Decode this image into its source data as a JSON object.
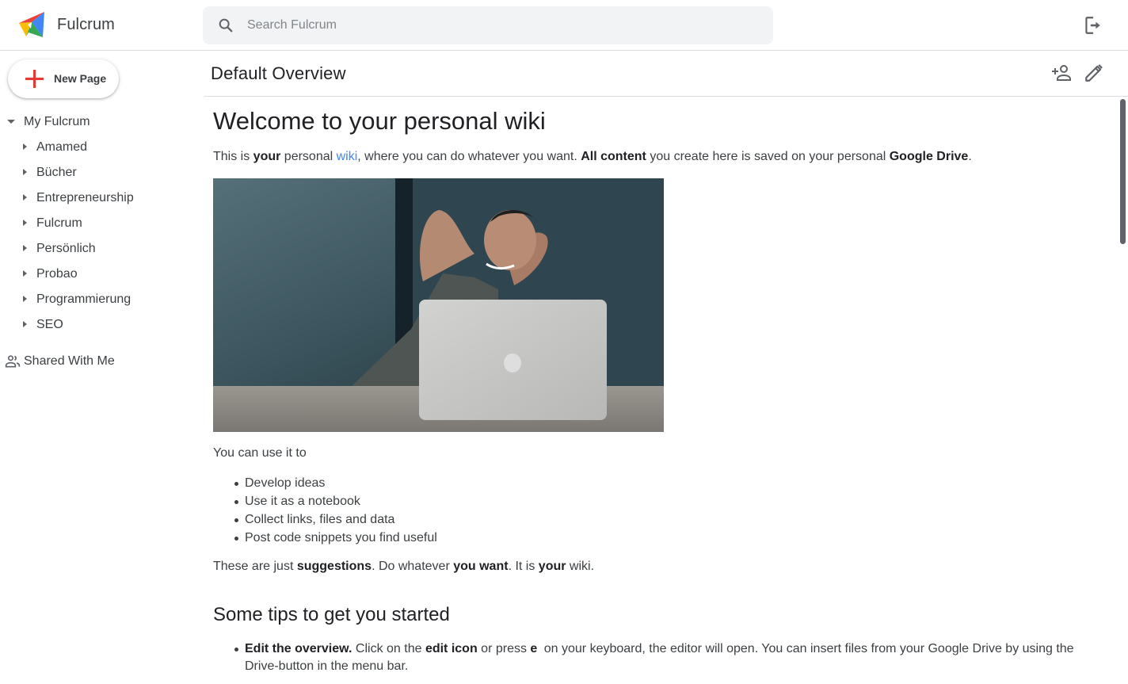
{
  "app": {
    "title": "Fulcrum",
    "logo_icon": "fulcrum-logo"
  },
  "search": {
    "placeholder": "Search Fulcrum",
    "value": "",
    "icon": "search-icon"
  },
  "topbar": {
    "logout_icon": "logout-icon"
  },
  "sidebar": {
    "new_page_label": "New Page",
    "root": {
      "label": "My Fulcrum",
      "expanded": true
    },
    "items": [
      {
        "label": "Amamed"
      },
      {
        "label": "Bücher"
      },
      {
        "label": "Entrepreneurship"
      },
      {
        "label": "Fulcrum"
      },
      {
        "label": "Persönlich"
      },
      {
        "label": "Probao"
      },
      {
        "label": "Programmierung"
      },
      {
        "label": "SEO"
      }
    ],
    "shared_label": "Shared With Me"
  },
  "page": {
    "title": "Default Overview",
    "actions": [
      "share-icon",
      "edit-icon"
    ]
  },
  "content": {
    "heading": "Welcome to your personal wiki",
    "intro": {
      "t1": "This is ",
      "b1": "your",
      "t2": " personal ",
      "link": "wiki",
      "t3": ", where you can do whatever you want. ",
      "b2": "All content",
      "t4": " you create here is saved on your personal ",
      "b3": "Google Drive",
      "t5": "."
    },
    "image_alt": "Man relaxing behind a laptop with hands behind his head",
    "use_intro": "You can use it to",
    "uses": [
      "Develop ideas",
      "Use it as a notebook",
      "Collect links, files and data",
      "Post code snippets you find useful"
    ],
    "suggest": {
      "t1": "These are just ",
      "b1": "suggestions",
      "t2": ". Do whatever ",
      "b2": "you want",
      "t3": ". It is ",
      "b3": "your",
      "t4": " wiki."
    },
    "tips_heading": "Some tips to get you started",
    "tips": [
      {
        "b1": "Edit the overview.",
        "t1": " Click on the ",
        "b2": "edit icon",
        "t2": " or press ",
        "key": "e",
        "t3": " on your keyboard, the editor will open. You can insert files from your Google Drive by using the Drive-button in the menu bar."
      }
    ]
  },
  "colors": {
    "accent_link": "#4285f4",
    "text": "#3c4043",
    "divider": "#dadce0",
    "search_bg": "#f1f3f4",
    "new_page_plus": "#e53935"
  }
}
